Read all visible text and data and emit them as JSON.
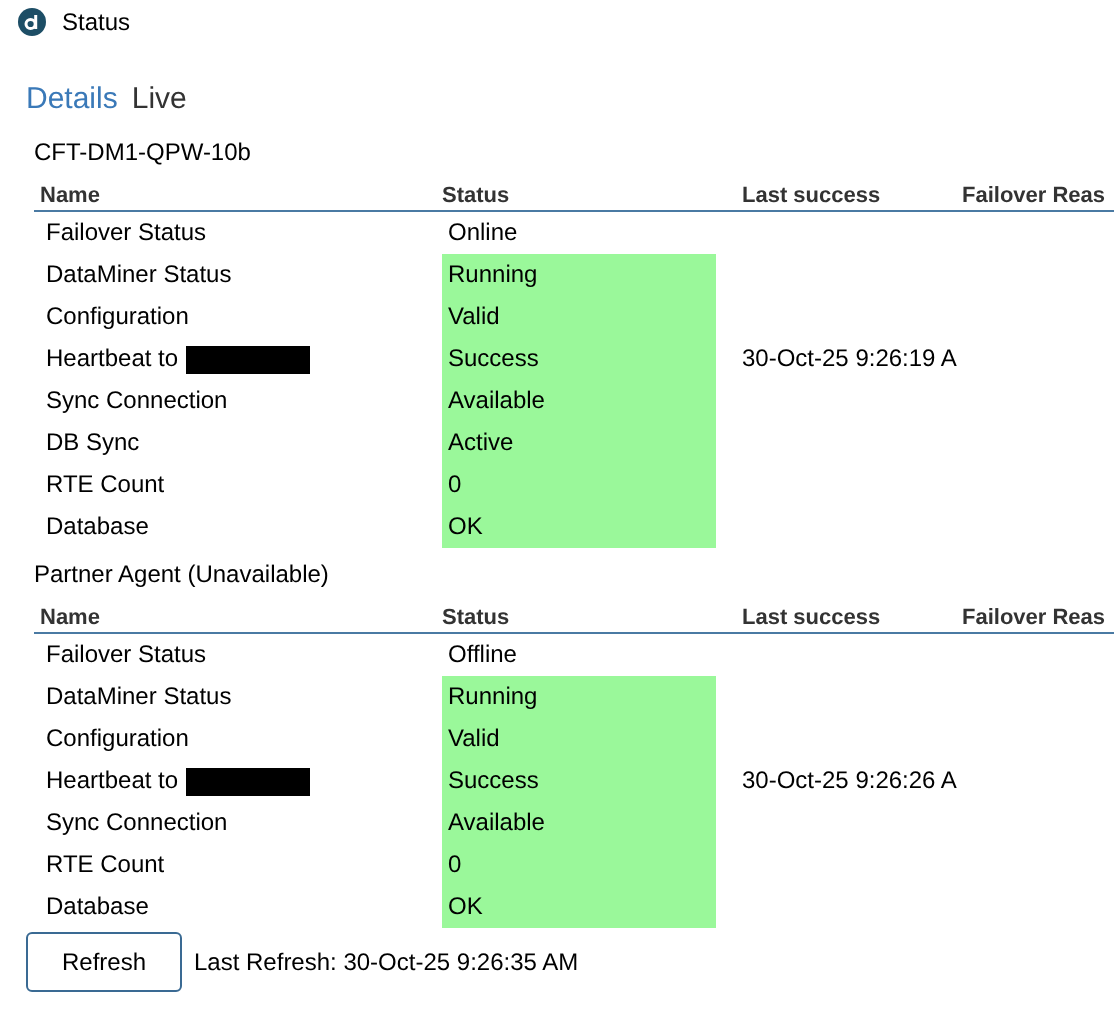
{
  "window": {
    "title": "Status"
  },
  "tabs": [
    {
      "label": "Details",
      "selected": true
    },
    {
      "label": "Live",
      "selected": false
    }
  ],
  "sections": [
    {
      "title": "CFT-DM1-QPW-10b",
      "columns": [
        "Name",
        "Status",
        "Last success",
        "Failover Reas"
      ],
      "rows": [
        {
          "name": "Failover Status",
          "status": "Online",
          "ok": false
        },
        {
          "name": "DataMiner Status",
          "status": "Running",
          "ok": true
        },
        {
          "name": "Configuration",
          "status": "Valid",
          "ok": true
        },
        {
          "name": "Heartbeat to",
          "redacted": true,
          "status": "Success",
          "last_success": "30-Oct-25 9:26:19 A",
          "ok": true
        },
        {
          "name": "Sync Connection",
          "status": "Available",
          "ok": true
        },
        {
          "name": "DB Sync",
          "status": "Active",
          "ok": true
        },
        {
          "name": "RTE Count",
          "status": "0",
          "ok": true
        },
        {
          "name": "Database",
          "status": "OK",
          "ok": true
        }
      ]
    },
    {
      "title": "Partner Agent (Unavailable)",
      "columns": [
        "Name",
        "Status",
        "Last success",
        "Failover Reas"
      ],
      "rows": [
        {
          "name": "Failover Status",
          "status": "Offline",
          "ok": false
        },
        {
          "name": "DataMiner Status",
          "status": "Running",
          "ok": true
        },
        {
          "name": "Configuration",
          "status": "Valid",
          "ok": true
        },
        {
          "name": "Heartbeat to",
          "redacted": true,
          "status": "Success",
          "last_success": "30-Oct-25 9:26:26 A",
          "ok": true
        },
        {
          "name": "Sync Connection",
          "status": "Available",
          "ok": true
        },
        {
          "name": "RTE Count",
          "status": "0",
          "ok": true
        },
        {
          "name": "Database",
          "status": "OK",
          "ok": true
        }
      ]
    }
  ],
  "footer": {
    "button": "Refresh",
    "last_refresh": "Last Refresh: 30-Oct-25 9:26:35 AM"
  }
}
